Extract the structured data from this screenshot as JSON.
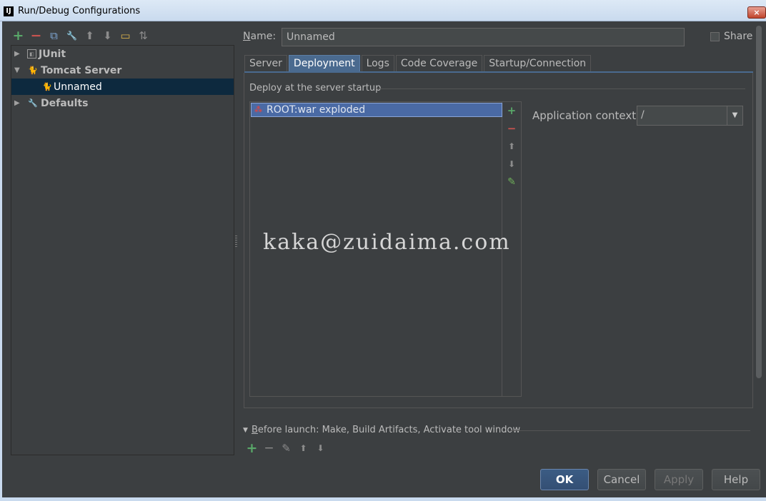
{
  "window": {
    "title": "Run/Debug Configurations",
    "app_icon": "IJ",
    "close_glyph": "×"
  },
  "left_toolbar": [
    {
      "name": "add-icon",
      "glyph": "+"
    },
    {
      "name": "remove-icon",
      "glyph": "−"
    },
    {
      "name": "copy-icon",
      "glyph": "⧉"
    },
    {
      "name": "edit-defaults-icon",
      "glyph": "🔧"
    },
    {
      "name": "move-up-icon",
      "glyph": "⬆"
    },
    {
      "name": "move-down-icon",
      "glyph": "⬇"
    },
    {
      "name": "folder-icon",
      "glyph": "▭"
    },
    {
      "name": "sort-icon",
      "glyph": "⇅"
    }
  ],
  "tree": {
    "junit": "JUnit",
    "tomcat_server": "Tomcat Server",
    "unnamed": "Unnamed",
    "defaults": "Defaults"
  },
  "name_field": {
    "label_first": "N",
    "label_rest": "ame:",
    "value": "Unnamed"
  },
  "share": {
    "label": "Share",
    "checked": false
  },
  "tabs": [
    "Server",
    "Deployment",
    "Logs",
    "Code Coverage",
    "Startup/Connection"
  ],
  "active_tab": "Deployment",
  "deployment": {
    "section_title": "Deploy at the server startup",
    "artifacts": [
      "ROOT:war exploded"
    ],
    "list_toolbar": {
      "add": "+",
      "remove": "−",
      "up": "⬆",
      "down": "⬇",
      "edit": "✎"
    },
    "app_context_label": "Application context:",
    "app_context_value": "/"
  },
  "watermark": "kaka@zuidaima.com",
  "before_launch": {
    "label_first": "B",
    "label_rest": "efore launch: Make, Build Artifacts, Activate tool window",
    "toolbar": {
      "add": "+",
      "remove": "−",
      "edit": "✎",
      "up": "⬆",
      "down": "⬇"
    }
  },
  "buttons": {
    "ok": "OK",
    "cancel": "Cancel",
    "apply": "Apply",
    "help": "Help"
  },
  "colors": {
    "accent": "#4a6a8f",
    "selection": "#0d293e",
    "add": "#59a869",
    "remove": "#c75450"
  }
}
